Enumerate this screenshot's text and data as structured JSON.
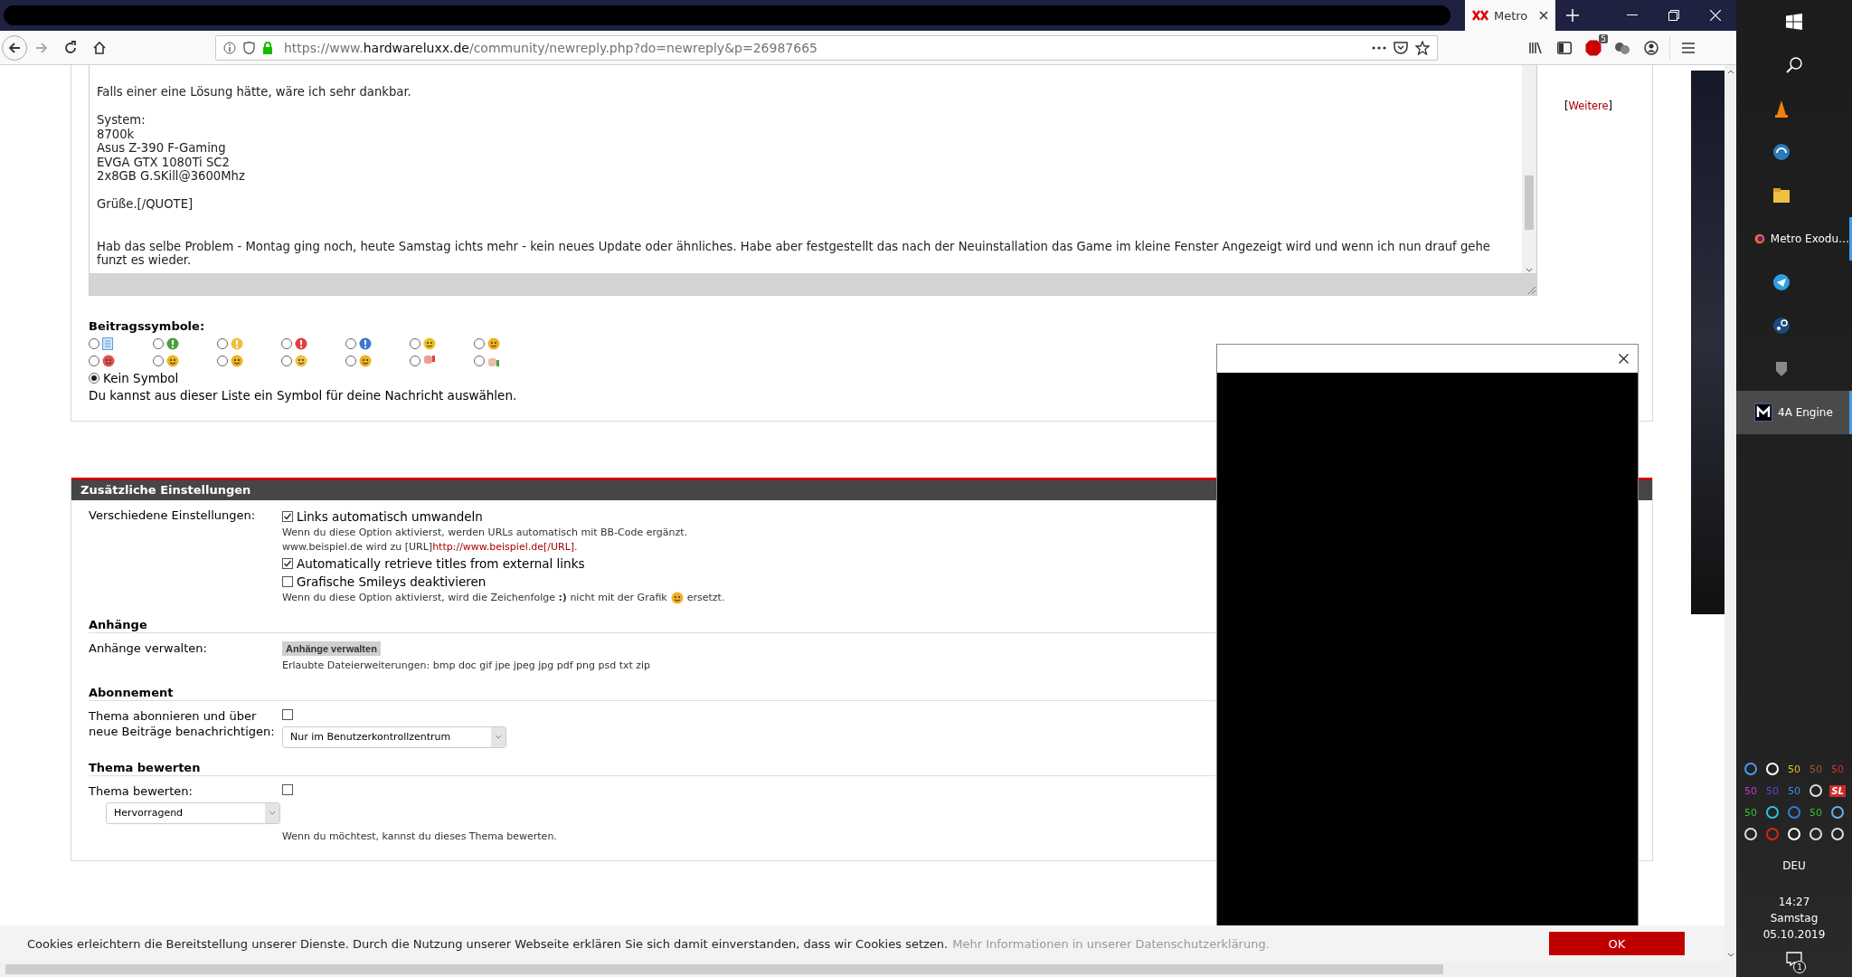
{
  "browser": {
    "tabs": [
      {
        "title": "Metro",
        "selected": true
      }
    ],
    "url": {
      "scheme": "https://www.",
      "domain": "hardwareluxx.de",
      "path": "/community/newreply.php?do=newreply&p=26987665"
    },
    "adblock_badge": "5"
  },
  "editor": {
    "quote_paragraphs": [
      [
        "Falls einer eine Lösung hätte, wäre ich sehr dankbar."
      ],
      [
        "System:",
        "8700k",
        "Asus Z-390 F-Gaming",
        "EVGA GTX 1080Ti SC2",
        "2x8GB G.SKill@3600Mhz"
      ],
      [
        "Grüße.[/QUOTE]"
      ]
    ],
    "reply": "Hab das selbe Problem - Montag ging noch, heute Samstag ichts mehr - kein neues Update oder ähnliches. Habe aber festgestellt das nach der Neuinstallation das Game im kleine Fenster Angezeigt wird und wenn ich nun drauf gehe funzt es wieder.",
    "more_link": {
      "open": "[",
      "label": "Weitere",
      "close": "]"
    }
  },
  "post_icons": {
    "title": "Beitragssymbole:",
    "icons": [
      {
        "selected": false
      },
      {
        "selected": false
      },
      {
        "selected": false
      },
      {
        "selected": false
      },
      {
        "selected": false
      },
      {
        "selected": false
      },
      {
        "selected": false
      },
      {
        "selected": false
      },
      {
        "selected": false
      },
      {
        "selected": false
      },
      {
        "selected": false
      },
      {
        "selected": false
      },
      {
        "selected": false
      },
      {
        "selected": false
      }
    ],
    "none": {
      "label": "Kein Symbol",
      "selected": true
    },
    "hint": "Du kannst aus dieser Liste ein Symbol für deine Nachricht auswählen."
  },
  "settings": {
    "title": "Zusätzliche Einstellungen",
    "misc": {
      "label": "Verschiedene Einstellungen:",
      "options": [
        {
          "label": "Links automatisch umwandeln",
          "checked": true
        },
        {
          "label": "Automatically retrieve titles from external links",
          "checked": true
        },
        {
          "label": "Grafische Smileys deaktivieren",
          "checked": false
        }
      ],
      "links_desc": "Wenn du diese Option aktivierst, werden URLs automatisch mit BB-Code ergänzt.",
      "example": {
        "text": "www.beispiel.de wird zu [URL]",
        "link": "http://www.beispiel.de[/URL]",
        "end": "."
      },
      "smiley_desc": {
        "before": "Wenn du diese Option aktivierst, wird die Zeichenfolge **:)** nicht mit der Grafik",
        "after": "ersetzt."
      }
    },
    "attachments": {
      "heading": "Anhänge",
      "label": "Anhänge verwalten:",
      "button": "Anhänge verwalten",
      "allowed": "Erlaubte Dateierweiterungen: bmp doc gif jpe jpeg jpg pdf png psd txt zip"
    },
    "subscription": {
      "heading": "Abonnement",
      "label": "Thema abonnieren und über neue Beiträge benachrichtigen:",
      "checked": false,
      "select": "Nur im Benutzerkontrollzentrum"
    },
    "rating": {
      "heading": "Thema bewerten",
      "label": "Thema bewerten:",
      "checked": false,
      "select": "Hervorragend",
      "hint": "Wenn du möchtest, kannst du dieses Thema bewerten."
    }
  },
  "cookie": {
    "text": "Cookies erleichtern die Bereitstellung unserer Dienste. Durch die Nutzung unserer Webseite erklären Sie sich damit einverstanden, dass wir Cookies setzen.",
    "link": "Mehr Informationen in unserer Datenschutzerklärung.",
    "button": "OK"
  },
  "taskbar": {
    "apps": [
      {
        "running": false,
        "selected": false
      },
      {
        "running": false,
        "selected": false
      },
      {
        "running": false,
        "selected": false
      },
      {
        "label": "Metro Exodu…",
        "running": true,
        "selected": false
      },
      {
        "running": false,
        "selected": false
      },
      {
        "running": false,
        "selected": false
      },
      {
        "running": false,
        "selected": false
      },
      {
        "label": "4A Engine",
        "running": true,
        "selected": true
      }
    ],
    "tray": [
      {
        "kind": "icon"
      },
      {
        "kind": "icon"
      },
      {
        "kind": "reading",
        "text": "50",
        "color": "#e8c020"
      },
      {
        "kind": "reading",
        "text": "50",
        "color": "#a85a28"
      },
      {
        "kind": "reading",
        "text": "50",
        "color": "#d83030"
      },
      {
        "kind": "reading",
        "text": "50",
        "color": "#c040c8"
      },
      {
        "kind": "reading",
        "text": "50",
        "color": "#6048d8"
      },
      {
        "kind": "reading",
        "text": "50",
        "color": "#3a90e0"
      },
      {
        "kind": "icon"
      },
      {
        "kind": "badge",
        "text": "SL",
        "color": "#d02828"
      },
      {
        "kind": "reading",
        "text": "50",
        "color": "#38c038"
      },
      {
        "kind": "icon"
      },
      {
        "kind": "icon"
      },
      {
        "kind": "reading",
        "text": "50",
        "color": "#38c038"
      },
      {
        "kind": "icon"
      },
      {
        "kind": "icon"
      },
      {
        "kind": "icon"
      },
      {
        "kind": "icon"
      },
      {
        "kind": "icon"
      },
      {
        "kind": "icon"
      }
    ],
    "language": "DEU",
    "time": "14:27",
    "day": "Samstag",
    "date": "05.10.2019",
    "notifications": "1"
  }
}
